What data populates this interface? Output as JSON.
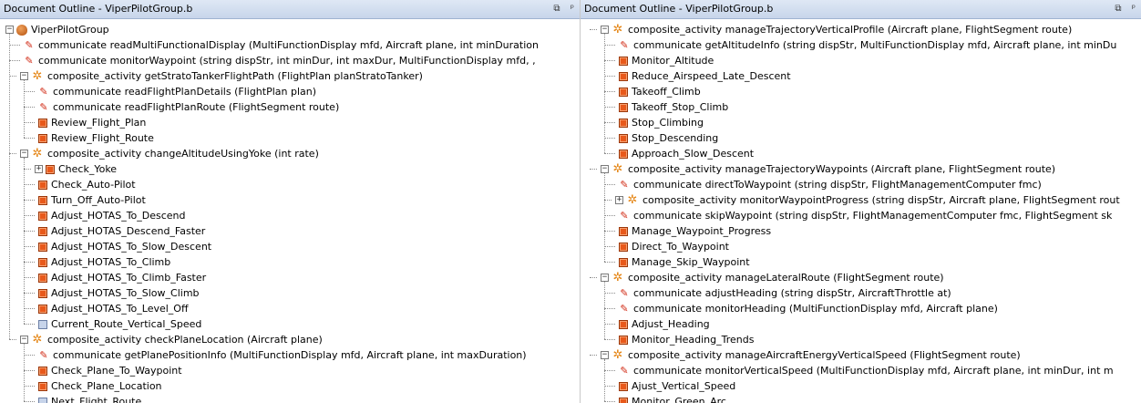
{
  "panels": [
    {
      "title": "Document Outline - ViperPilotGroup.b",
      "float_glyph": "⧉",
      "pin_glyph": "ᵖ",
      "rows": [
        {
          "level": 0,
          "expand": "-",
          "icon": "root",
          "label": "ViperPilotGroup"
        },
        {
          "level": 1,
          "icon": "communicate",
          "label": "communicate readMultiFunctionalDisplay (MultiFunctionDisplay mfd, Aircraft plane, int minDuration"
        },
        {
          "level": 1,
          "icon": "communicate",
          "label": "communicate monitorWaypoint (string dispStr, int minDur, int maxDur, MultiFunctionDisplay mfd, ,"
        },
        {
          "level": 1,
          "expand": "-",
          "icon": "composite",
          "label": "composite_activity getStratoTankerFlightPath (FlightPlan planStratoTanker)"
        },
        {
          "level": 2,
          "icon": "communicate",
          "label": "communicate readFlightPlanDetails (FlightPlan plan)"
        },
        {
          "level": 2,
          "icon": "communicate",
          "label": "communicate readFlightPlanRoute (FlightSegment route)"
        },
        {
          "level": 2,
          "icon": "activity",
          "label": "Review_Flight_Plan"
        },
        {
          "level": 2,
          "icon": "activity",
          "label": "Review_Flight_Route"
        },
        {
          "level": 1,
          "expand": "-",
          "icon": "composite",
          "label": "composite_activity changeAltitudeUsingYoke (int rate)"
        },
        {
          "level": 2,
          "expand": "+",
          "icon": "activity",
          "label": "Check_Yoke"
        },
        {
          "level": 2,
          "icon": "activity",
          "label": "Check_Auto-Pilot"
        },
        {
          "level": 2,
          "icon": "activity",
          "label": "Turn_Off_Auto-Pilot"
        },
        {
          "level": 2,
          "icon": "activity",
          "label": "Adjust_HOTAS_To_Descend"
        },
        {
          "level": 2,
          "icon": "activity",
          "label": "Adjust_HOTAS_Descend_Faster"
        },
        {
          "level": 2,
          "icon": "activity",
          "label": "Adjust_HOTAS_To_Slow_Descent"
        },
        {
          "level": 2,
          "icon": "activity",
          "label": "Adjust_HOTAS_To_Climb"
        },
        {
          "level": 2,
          "icon": "activity",
          "label": "Adjust_HOTAS_To_Climb_Faster"
        },
        {
          "level": 2,
          "icon": "activity",
          "label": "Adjust_HOTAS_To_Slow_Climb"
        },
        {
          "level": 2,
          "icon": "activity",
          "label": "Adjust_HOTAS_To_Level_Off"
        },
        {
          "level": 2,
          "icon": "activity-blue",
          "label": "Current_Route_Vertical_Speed"
        },
        {
          "level": 1,
          "expand": "-",
          "icon": "composite",
          "label": "composite_activity checkPlaneLocation (Aircraft plane)"
        },
        {
          "level": 2,
          "icon": "communicate",
          "label": "communicate getPlanePositionInfo (MultiFunctionDisplay mfd, Aircraft plane, int maxDuration)"
        },
        {
          "level": 2,
          "icon": "activity",
          "label": "Check_Plane_To_Waypoint"
        },
        {
          "level": 2,
          "icon": "activity",
          "label": "Check_Plane_Location"
        },
        {
          "level": 2,
          "icon": "activity-blue",
          "label": "Next_Flight_Route"
        }
      ]
    },
    {
      "title": "Document Outline - ViperPilotGroup.b",
      "float_glyph": "⧉",
      "pin_glyph": "ᵖ",
      "rows": [
        {
          "level": 1,
          "expand": "-",
          "icon": "composite",
          "label": "composite_activity manageTrajectoryVerticalProfile (Aircraft plane, FlightSegment route)"
        },
        {
          "level": 2,
          "icon": "communicate",
          "label": "communicate getAltitudeInfo (string dispStr, MultiFunctionDisplay mfd, Aircraft plane, int minDu"
        },
        {
          "level": 2,
          "icon": "activity",
          "label": "Monitor_Altitude"
        },
        {
          "level": 2,
          "icon": "activity",
          "label": "Reduce_Airspeed_Late_Descent"
        },
        {
          "level": 2,
          "icon": "activity",
          "label": "Takeoff_Climb"
        },
        {
          "level": 2,
          "icon": "activity",
          "label": "Takeoff_Stop_Climb"
        },
        {
          "level": 2,
          "icon": "activity",
          "label": "Stop_Climbing"
        },
        {
          "level": 2,
          "icon": "activity",
          "label": "Stop_Descending"
        },
        {
          "level": 2,
          "icon": "activity",
          "label": "Approach_Slow_Descent"
        },
        {
          "level": 1,
          "expand": "-",
          "icon": "composite",
          "label": "composite_activity manageTrajectoryWaypoints (Aircraft plane, FlightSegment route)"
        },
        {
          "level": 2,
          "icon": "communicate",
          "label": "communicate directToWaypoint (string dispStr, FlightManagementComputer fmc)"
        },
        {
          "level": 2,
          "expand": "+",
          "icon": "composite",
          "label": "composite_activity monitorWaypointProgress (string dispStr, Aircraft plane, FlightSegment rout"
        },
        {
          "level": 2,
          "icon": "communicate",
          "label": "communicate skipWaypoint (string dispStr, FlightManagementComputer fmc, FlightSegment sk"
        },
        {
          "level": 2,
          "icon": "activity",
          "label": "Manage_Waypoint_Progress"
        },
        {
          "level": 2,
          "icon": "activity",
          "label": "Direct_To_Waypoint"
        },
        {
          "level": 2,
          "icon": "activity",
          "label": "Manage_Skip_Waypoint"
        },
        {
          "level": 1,
          "expand": "-",
          "icon": "composite",
          "label": "composite_activity manageLateralRoute (FlightSegment route)"
        },
        {
          "level": 2,
          "icon": "communicate",
          "label": "communicate adjustHeading (string dispStr, AircraftThrottle at)"
        },
        {
          "level": 2,
          "icon": "communicate",
          "label": "communicate monitorHeading (MultiFunctionDisplay mfd, Aircraft plane)"
        },
        {
          "level": 2,
          "icon": "activity",
          "label": "Adjust_Heading"
        },
        {
          "level": 2,
          "icon": "activity",
          "label": "Monitor_Heading_Trends"
        },
        {
          "level": 1,
          "expand": "-",
          "icon": "composite",
          "label": "composite_activity manageAircraftEnergyVerticalSpeed (FlightSegment route)"
        },
        {
          "level": 2,
          "icon": "communicate",
          "label": "communicate monitorVerticalSpeed (MultiFunctionDisplay mfd, Aircraft plane, int minDur, int m"
        },
        {
          "level": 2,
          "icon": "activity",
          "label": "Ajust_Vertical_Speed"
        },
        {
          "level": 2,
          "icon": "activity",
          "label": "Monitor_Green_Arc"
        }
      ]
    }
  ]
}
